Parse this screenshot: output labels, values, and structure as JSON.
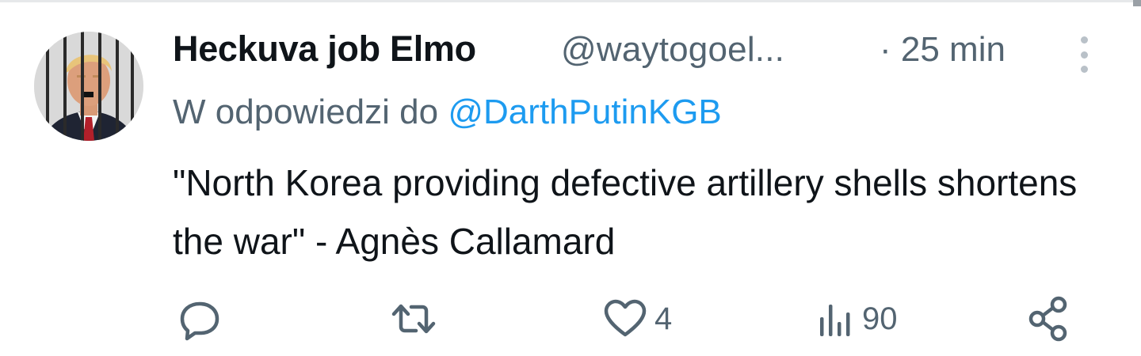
{
  "tweet": {
    "display_name": "Heckuva job Elmo",
    "handle": "@waytogoel...",
    "separator": "·",
    "time": "25 min",
    "reply_prefix": "W odpowiedzi do",
    "reply_to": "@DarthPutinKGB",
    "text": "\"North Korea providing defective artillery shells shortens the war\" - Agnès Callamard"
  },
  "actions": {
    "reply": {
      "icon": "reply-icon",
      "count": ""
    },
    "retweet": {
      "icon": "retweet-icon",
      "count": ""
    },
    "like": {
      "icon": "heart-icon",
      "count": "4"
    },
    "views": {
      "icon": "views-icon",
      "count": "90"
    },
    "share": {
      "icon": "share-icon"
    }
  },
  "colors": {
    "text_primary": "#0f1419",
    "text_secondary": "#536471",
    "link": "#1d9bf0",
    "icon": "#536471"
  }
}
